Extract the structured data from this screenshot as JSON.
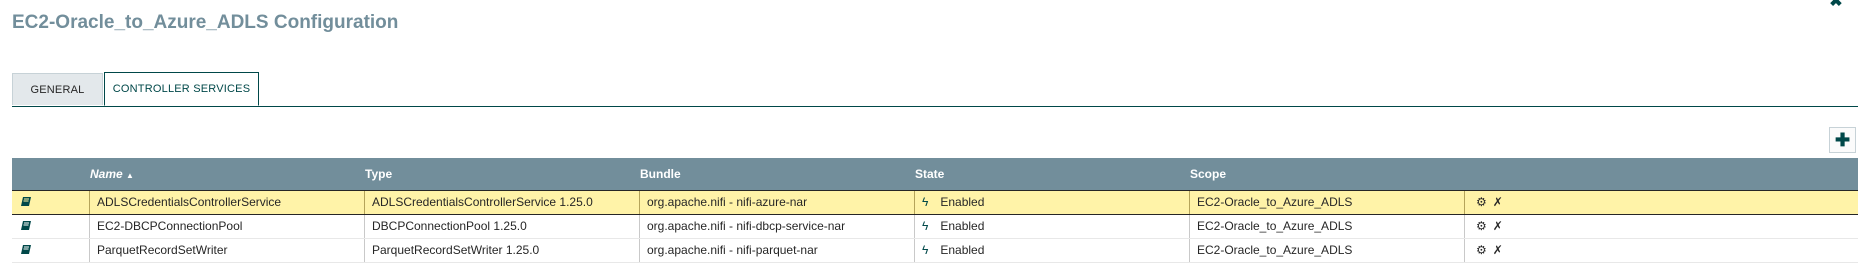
{
  "dialog": {
    "title": "EC2-Oracle_to_Azure_ADLS Configuration",
    "close_icon": "close-icon"
  },
  "tabs": [
    {
      "label": "General"
    },
    {
      "label": "Controller Services"
    }
  ],
  "add_button": {
    "icon": "plus-icon"
  },
  "table": {
    "headers": {
      "name": "Name",
      "sort_indicator": "▲",
      "type": "Type",
      "bundle": "Bundle",
      "state": "State",
      "scope": "Scope"
    },
    "rows": [
      {
        "name": "ADLSCredentialsControllerService",
        "type": "ADLSCredentialsControllerService 1.25.0",
        "bundle": "org.apache.nifi - nifi-azure-nar",
        "state": "Enabled",
        "scope": "EC2-Oracle_to_Azure_ADLS",
        "selected": true
      },
      {
        "name": "EC2-DBCPConnectionPool",
        "type": "DBCPConnectionPool 1.25.0",
        "bundle": "org.apache.nifi - nifi-dbcp-service-nar",
        "state": "Enabled",
        "scope": "EC2-Oracle_to_Azure_ADLS",
        "selected": false
      },
      {
        "name": "ParquetRecordSetWriter",
        "type": "ParquetRecordSetWriter 1.25.0",
        "bundle": "org.apache.nifi - nifi-parquet-nar",
        "state": "Enabled",
        "scope": "EC2-Oracle_to_Azure_ADLS",
        "selected": false
      }
    ]
  },
  "colors": {
    "title": "#728e9b",
    "header_bg": "#728e9b",
    "selected_row": "#fff3a8",
    "accent": "#004849"
  }
}
